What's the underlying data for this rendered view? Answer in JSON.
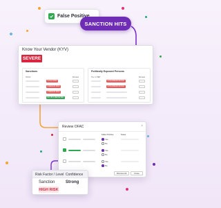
{
  "false_positive": {
    "label": "False Positive",
    "checked": true
  },
  "sanction_hits": {
    "label": "SANCTION HITS"
  },
  "kyv": {
    "title": "Know Your Vendor (KYV)",
    "severity": "SEVERE",
    "sanctions": {
      "title": "Sanctions",
      "col_name": "OFAC",
      "col_review": "Review",
      "tags": [
        "5 HIGH RISK",
        "2 MEDIUM RISK",
        "2 MEDIUM RISK",
        "NO HITS REPORTED"
      ]
    },
    "pep": {
      "title": "Politically Exposed Persons",
      "col_name": "Tier 1 PEP",
      "col_review": "Review",
      "tags": [
        "2 HIGH/MEDIUM RISK",
        "2 HIGH/MEDIUM RISK"
      ]
    }
  },
  "ofac": {
    "title": "Review OFAC",
    "close": "×",
    "col_false_positive": "False Positive",
    "col_notes": "Notes",
    "radio_yes": "Yes",
    "radio_no": "No",
    "buttons": {
      "dismiss": "Dismiss All",
      "close": "Close"
    },
    "rows": [
      {
        "checked": false,
        "selected": "yes",
        "notes": ""
      },
      {
        "checked": true,
        "selected": "yes",
        "notes": ""
      },
      {
        "checked": false,
        "selected": "no",
        "notes": ""
      }
    ]
  },
  "risk": {
    "col_factor": "Risk Factor / Level",
    "col_confidence": "Confidence",
    "factor": "Sanction",
    "confidence": "Strong",
    "level": "HIGH RISK"
  },
  "colors": {
    "accent": "#6f2db6",
    "severe": "#d7263d",
    "connector_purple": "#7b2fd0",
    "connector_orange": "#f3a53a",
    "check_green": "#2fa84f"
  }
}
